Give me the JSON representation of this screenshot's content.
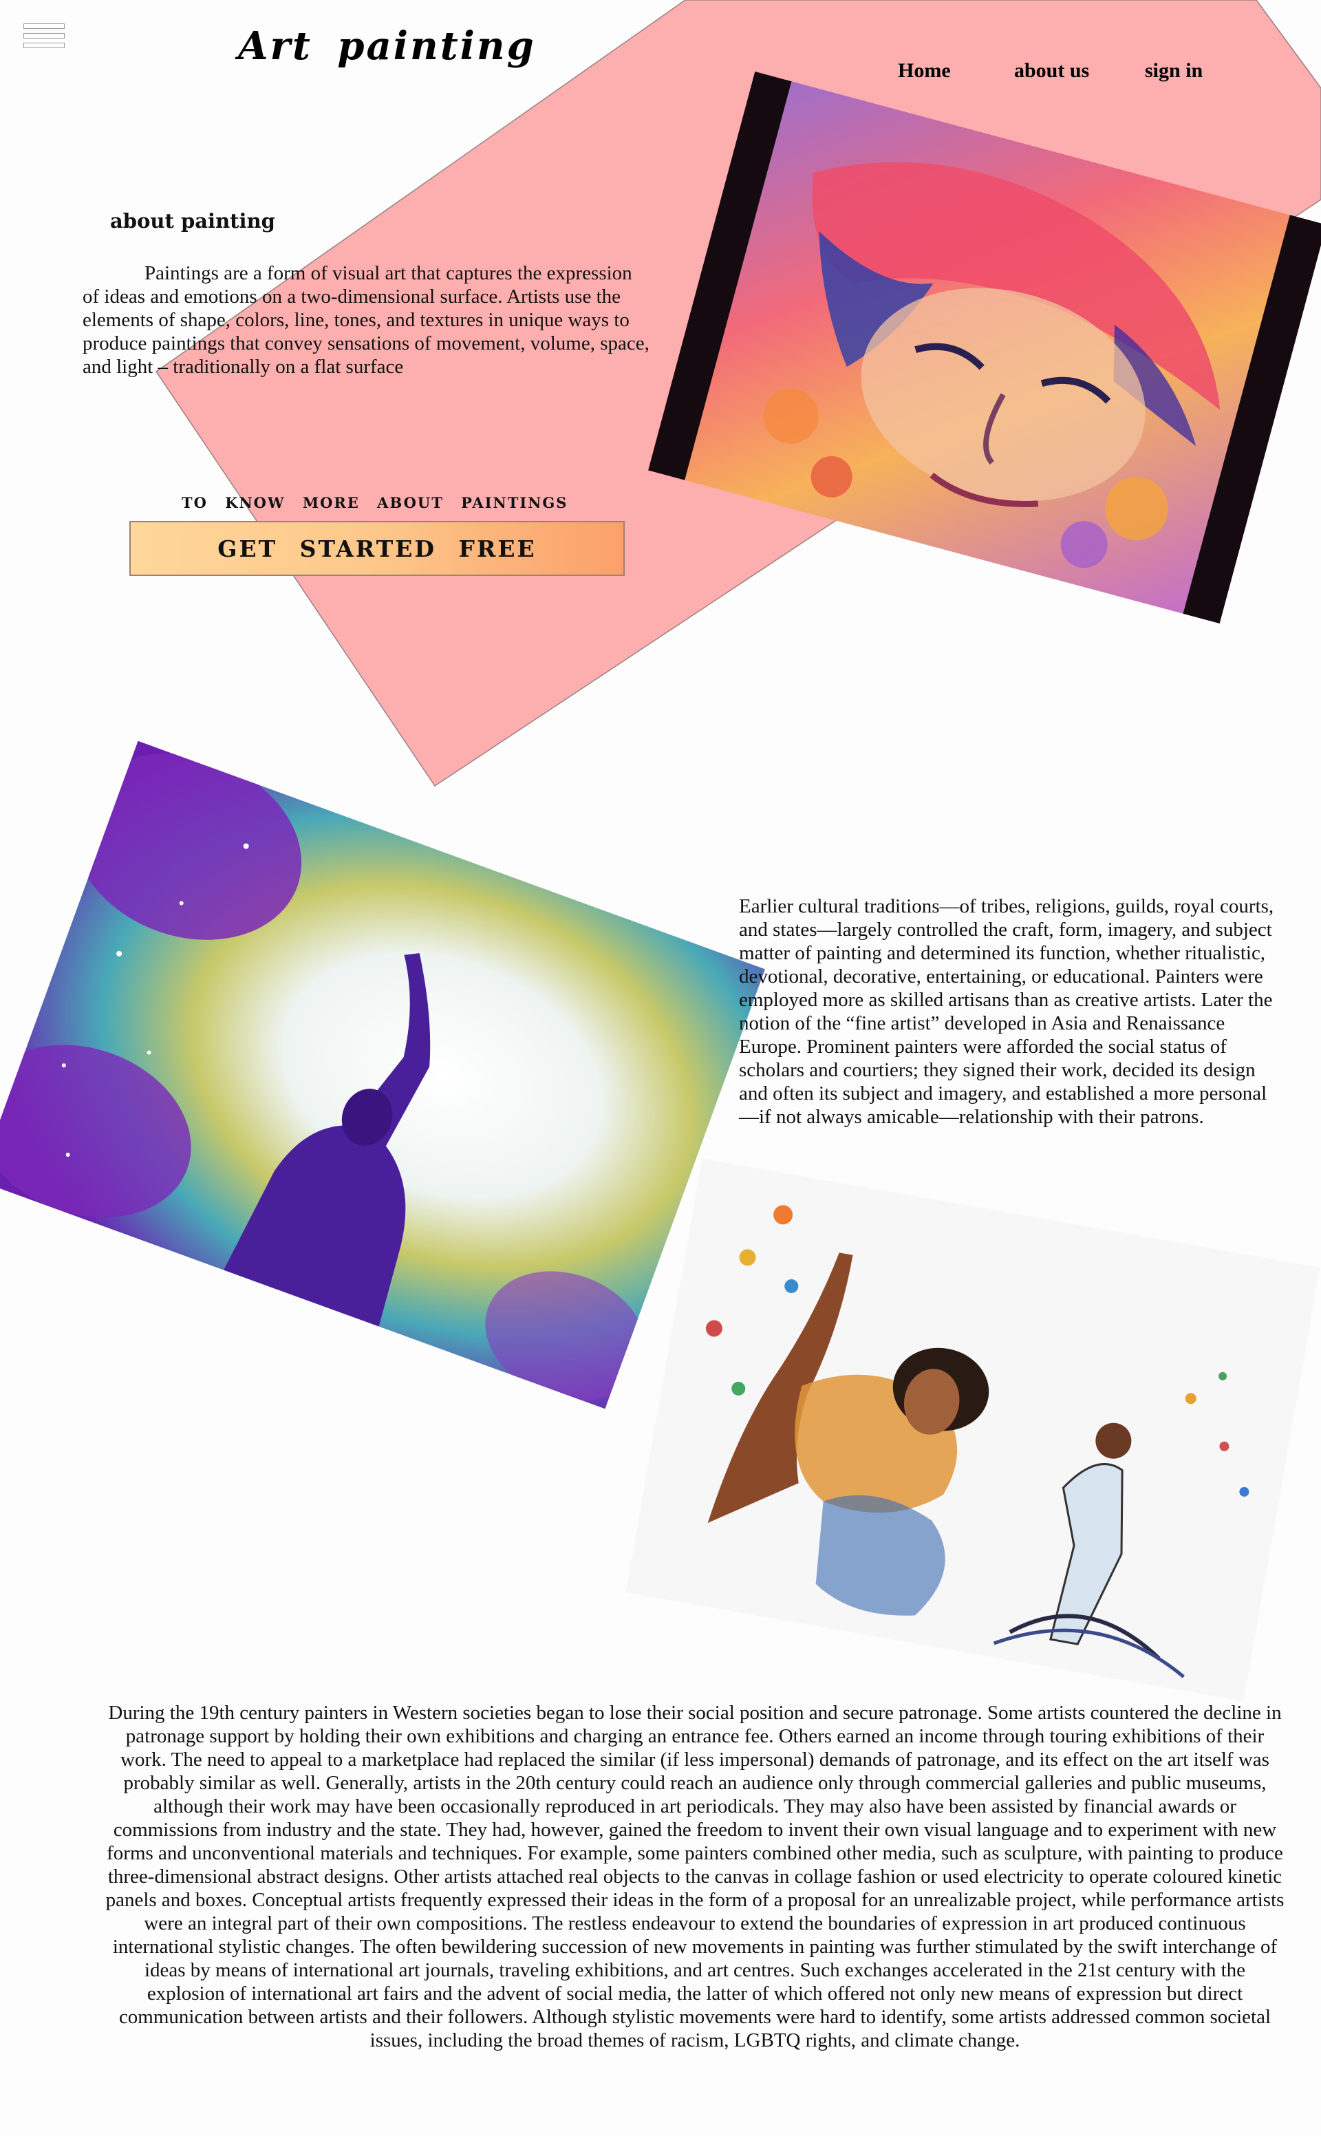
{
  "brand": {
    "logo_text": "Art  painting"
  },
  "nav": {
    "home": "Home",
    "about": "about us",
    "signin": "sign in"
  },
  "menu": {
    "icon": "hamburger-menu-icon"
  },
  "hero": {
    "heading": "about painting",
    "paragraph": "Paintings are a form of visual art that captures the expression of ideas and emotions on a two-dimensional surface. Artists use the elements of shape, colors, line, tones, and textures in unique ways to produce paintings that convey sensations of movement, volume, space, and light – traditionally on a flat surface",
    "cta_label": "TO  KNOW  MORE  ABOUT  PAINTINGS",
    "cta_button": "GET  STARTED  FREE"
  },
  "history": {
    "paragraph1": "Earlier cultural traditions—of tribes, religions, guilds, royal courts, and states—largely controlled the craft, form, imagery, and subject matter of painting and determined its function, whether ritualistic, devotional, decorative, entertaining, or educational. Painters were employed more as skilled artisans than as creative artists. Later the notion of the “fine artist” developed in Asia and Renaissance Europe. Prominent painters were afforded the social status of scholars and courtiers; they signed their work, decided its design and often its subject and imagery, and established a more personal—if not always amicable—relationship with their patrons.",
    "paragraph2": "During the 19th century painters in Western societies began to lose their social position and secure patronage. Some artists countered the decline in patronage support by holding their own exhibitions and charging an entrance fee. Others earned an income through touring exhibitions of their work. The need to appeal to a marketplace had replaced the similar (if less impersonal) demands of patronage, and its effect on the art itself was probably similar as well. Generally, artists in the 20th century could reach an audience only through commercial galleries and public museums, although their work may have been occasionally reproduced in art periodicals. They may also have been assisted by financial awards or commissions from industry and the state. They had, however, gained the freedom to invent their own visual language and to experiment with new forms and unconventional materials and techniques. For example, some painters combined other media, such as sculpture, with painting to produce three-dimensional abstract designs. Other artists attached real objects to the canvas in collage fashion or used electricity to operate coloured kinetic panels and boxes. Conceptual artists frequently expressed their ideas in the form of a proposal for an unrealizable project, while performance artists were an integral part of their own compositions. The restless endeavour to extend the boundaries of expression in art produced continuous international stylistic changes. The often bewildering succession of new movements in painting was further stimulated by the swift interchange of ideas by means of international art journals, traveling exhibitions, and art centres. Such exchanges accelerated in the 21st century with the explosion of international art fairs and the advent of social media, the latter of which offered not only new means of expression but direct communication between artists and their followers. Although stylistic movements were hard to identify, some artists addressed common societal issues, including the broad themes of racism, LGBTQ rights, and climate change."
  },
  "colors": {
    "pink_shape": "#fdaeae",
    "cta_start": "#fed79a",
    "cta_end": "#fca06a"
  }
}
